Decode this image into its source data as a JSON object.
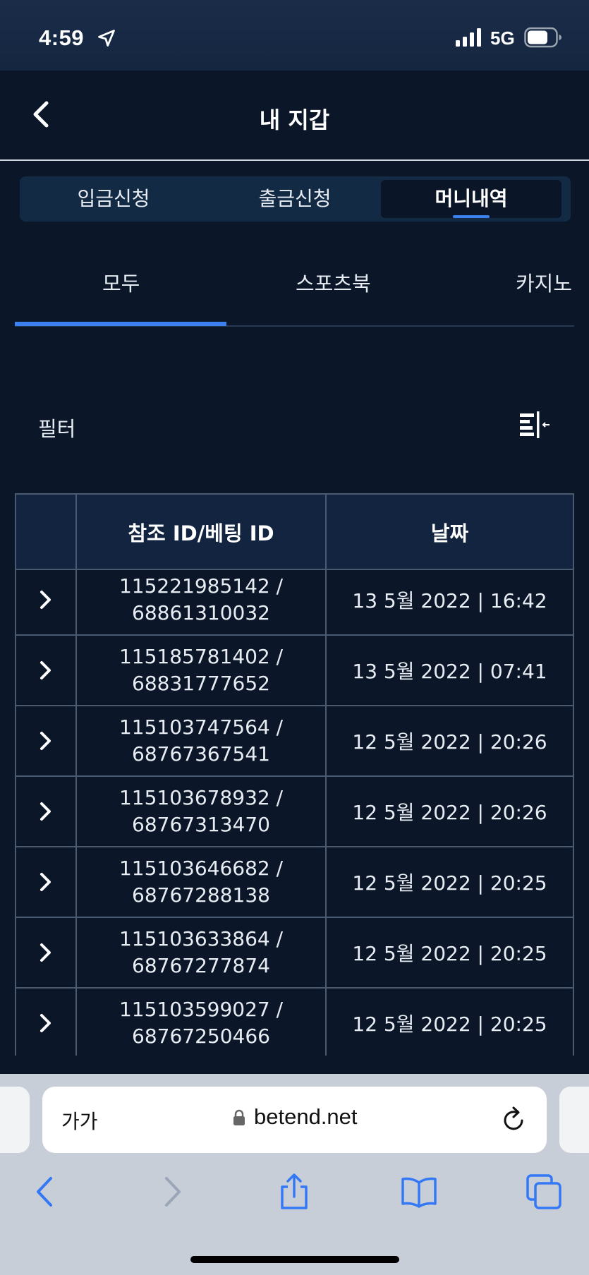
{
  "status_bar": {
    "time": "4:59",
    "network": "5G"
  },
  "header": {
    "title": "내 지갑"
  },
  "segment_tabs": [
    {
      "label": "입금신청",
      "active": false
    },
    {
      "label": "출금신청",
      "active": false
    },
    {
      "label": "머니내역",
      "active": true
    }
  ],
  "category_tabs": [
    {
      "label": "모두",
      "active": true
    },
    {
      "label": "스포츠북",
      "active": false
    },
    {
      "label": "카지노",
      "active": false
    }
  ],
  "filter": {
    "label": "필터"
  },
  "table": {
    "headers": [
      "",
      "참조 ID/베팅 ID",
      "날짜"
    ],
    "rows": [
      {
        "id": "115221985142 /\n68861310032",
        "date": "13 5월 2022 | 16:42"
      },
      {
        "id": "115185781402 /\n68831777652",
        "date": "13 5월 2022 | 07:41"
      },
      {
        "id": "115103747564 /\n68767367541",
        "date": "12 5월 2022 | 20:26"
      },
      {
        "id": "115103678932 /\n68767313470",
        "date": "12 5월 2022 | 20:26"
      },
      {
        "id": "115103646682 /\n68767288138",
        "date": "12 5월 2022 | 20:25"
      },
      {
        "id": "115103633864 /\n68767277874",
        "date": "12 5월 2022 | 20:25"
      },
      {
        "id": "115103599027 /\n68767250466",
        "date": "12 5월 2022 | 20:25"
      }
    ]
  },
  "browser": {
    "text_size_label": "가가",
    "url": "betend.net"
  },
  "colors": {
    "background": "#0b1729",
    "accent": "#3b82f0",
    "header_row": "#122440",
    "browser_icon": "#3478f6"
  },
  "icons": {
    "back": "chevron-left-icon",
    "filter": "filter-icon",
    "row": "chevron-right-icon",
    "lock": "lock-icon",
    "reload": "reload-icon"
  }
}
